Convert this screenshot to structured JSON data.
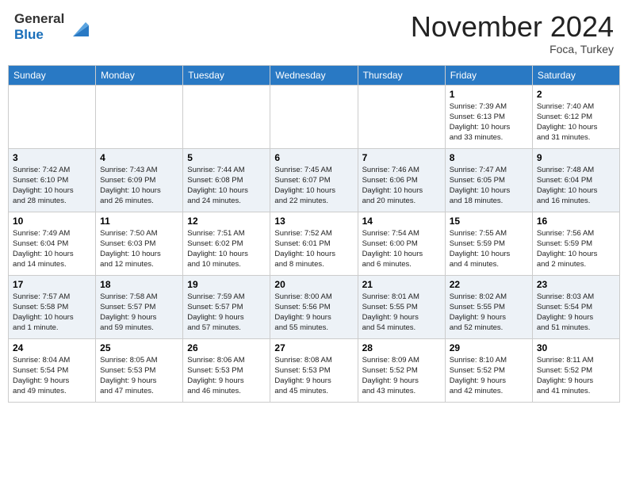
{
  "header": {
    "logo_line1": "General",
    "logo_line2": "Blue",
    "month_year": "November 2024",
    "location": "Foca, Turkey"
  },
  "weekdays": [
    "Sunday",
    "Monday",
    "Tuesday",
    "Wednesday",
    "Thursday",
    "Friday",
    "Saturday"
  ],
  "weeks": [
    [
      {
        "day": null,
        "info": null
      },
      {
        "day": null,
        "info": null
      },
      {
        "day": null,
        "info": null
      },
      {
        "day": null,
        "info": null
      },
      {
        "day": null,
        "info": null
      },
      {
        "day": "1",
        "info": "Sunrise: 7:39 AM\nSunset: 6:13 PM\nDaylight: 10 hours\nand 33 minutes."
      },
      {
        "day": "2",
        "info": "Sunrise: 7:40 AM\nSunset: 6:12 PM\nDaylight: 10 hours\nand 31 minutes."
      }
    ],
    [
      {
        "day": "3",
        "info": "Sunrise: 7:42 AM\nSunset: 6:10 PM\nDaylight: 10 hours\nand 28 minutes."
      },
      {
        "day": "4",
        "info": "Sunrise: 7:43 AM\nSunset: 6:09 PM\nDaylight: 10 hours\nand 26 minutes."
      },
      {
        "day": "5",
        "info": "Sunrise: 7:44 AM\nSunset: 6:08 PM\nDaylight: 10 hours\nand 24 minutes."
      },
      {
        "day": "6",
        "info": "Sunrise: 7:45 AM\nSunset: 6:07 PM\nDaylight: 10 hours\nand 22 minutes."
      },
      {
        "day": "7",
        "info": "Sunrise: 7:46 AM\nSunset: 6:06 PM\nDaylight: 10 hours\nand 20 minutes."
      },
      {
        "day": "8",
        "info": "Sunrise: 7:47 AM\nSunset: 6:05 PM\nDaylight: 10 hours\nand 18 minutes."
      },
      {
        "day": "9",
        "info": "Sunrise: 7:48 AM\nSunset: 6:04 PM\nDaylight: 10 hours\nand 16 minutes."
      }
    ],
    [
      {
        "day": "10",
        "info": "Sunrise: 7:49 AM\nSunset: 6:04 PM\nDaylight: 10 hours\nand 14 minutes."
      },
      {
        "day": "11",
        "info": "Sunrise: 7:50 AM\nSunset: 6:03 PM\nDaylight: 10 hours\nand 12 minutes."
      },
      {
        "day": "12",
        "info": "Sunrise: 7:51 AM\nSunset: 6:02 PM\nDaylight: 10 hours\nand 10 minutes."
      },
      {
        "day": "13",
        "info": "Sunrise: 7:52 AM\nSunset: 6:01 PM\nDaylight: 10 hours\nand 8 minutes."
      },
      {
        "day": "14",
        "info": "Sunrise: 7:54 AM\nSunset: 6:00 PM\nDaylight: 10 hours\nand 6 minutes."
      },
      {
        "day": "15",
        "info": "Sunrise: 7:55 AM\nSunset: 5:59 PM\nDaylight: 10 hours\nand 4 minutes."
      },
      {
        "day": "16",
        "info": "Sunrise: 7:56 AM\nSunset: 5:59 PM\nDaylight: 10 hours\nand 2 minutes."
      }
    ],
    [
      {
        "day": "17",
        "info": "Sunrise: 7:57 AM\nSunset: 5:58 PM\nDaylight: 10 hours\nand 1 minute."
      },
      {
        "day": "18",
        "info": "Sunrise: 7:58 AM\nSunset: 5:57 PM\nDaylight: 9 hours\nand 59 minutes."
      },
      {
        "day": "19",
        "info": "Sunrise: 7:59 AM\nSunset: 5:57 PM\nDaylight: 9 hours\nand 57 minutes."
      },
      {
        "day": "20",
        "info": "Sunrise: 8:00 AM\nSunset: 5:56 PM\nDaylight: 9 hours\nand 55 minutes."
      },
      {
        "day": "21",
        "info": "Sunrise: 8:01 AM\nSunset: 5:55 PM\nDaylight: 9 hours\nand 54 minutes."
      },
      {
        "day": "22",
        "info": "Sunrise: 8:02 AM\nSunset: 5:55 PM\nDaylight: 9 hours\nand 52 minutes."
      },
      {
        "day": "23",
        "info": "Sunrise: 8:03 AM\nSunset: 5:54 PM\nDaylight: 9 hours\nand 51 minutes."
      }
    ],
    [
      {
        "day": "24",
        "info": "Sunrise: 8:04 AM\nSunset: 5:54 PM\nDaylight: 9 hours\nand 49 minutes."
      },
      {
        "day": "25",
        "info": "Sunrise: 8:05 AM\nSunset: 5:53 PM\nDaylight: 9 hours\nand 47 minutes."
      },
      {
        "day": "26",
        "info": "Sunrise: 8:06 AM\nSunset: 5:53 PM\nDaylight: 9 hours\nand 46 minutes."
      },
      {
        "day": "27",
        "info": "Sunrise: 8:08 AM\nSunset: 5:53 PM\nDaylight: 9 hours\nand 45 minutes."
      },
      {
        "day": "28",
        "info": "Sunrise: 8:09 AM\nSunset: 5:52 PM\nDaylight: 9 hours\nand 43 minutes."
      },
      {
        "day": "29",
        "info": "Sunrise: 8:10 AM\nSunset: 5:52 PM\nDaylight: 9 hours\nand 42 minutes."
      },
      {
        "day": "30",
        "info": "Sunrise: 8:11 AM\nSunset: 5:52 PM\nDaylight: 9 hours\nand 41 minutes."
      }
    ]
  ]
}
